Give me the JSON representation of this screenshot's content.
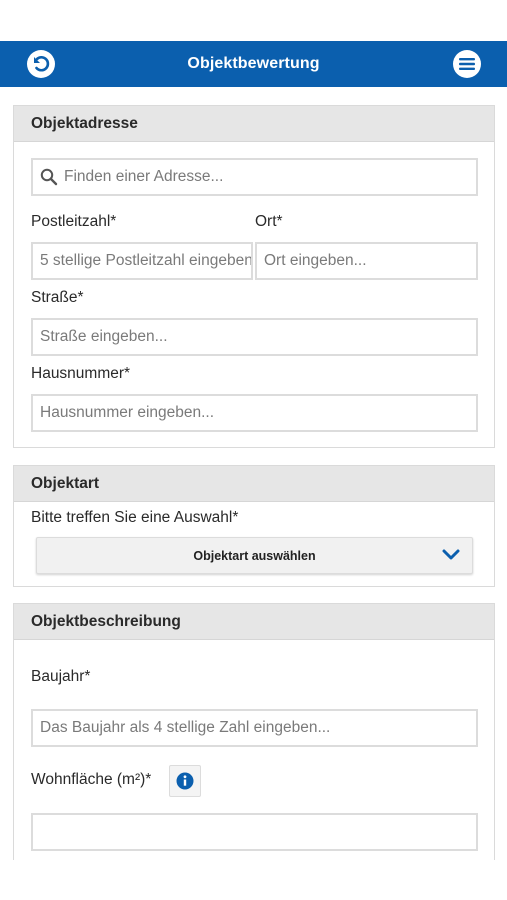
{
  "header": {
    "title": "Objektbewertung",
    "back_icon": "back-arrow-icon",
    "menu_icon": "menu-icon",
    "color": "#0b5fae"
  },
  "address": {
    "heading": "Objektadresse",
    "search_placeholder": "Finden einer Adresse...",
    "postcode_label": "Postleitzahl*",
    "postcode_placeholder": "5 stellige Postleitzahl eingeben...",
    "city_label": "Ort*",
    "city_placeholder": "Ort eingeben...",
    "street_label": "Straße*",
    "street_placeholder": "Straße eingeben...",
    "house_label": "Hausnummer*",
    "house_placeholder": "Hausnummer eingeben..."
  },
  "object_type": {
    "heading": "Objektart",
    "prompt": "Bitte treffen Sie eine Auswahl*",
    "select_label": "Objektart auswählen"
  },
  "description": {
    "heading": "Objektbeschreibung",
    "year_label": "Baujahr*",
    "year_placeholder": "Das Baujahr als 4 stellige Zahl eingeben...",
    "area_label": "Wohnfläche (m²)*",
    "area_value": ""
  }
}
